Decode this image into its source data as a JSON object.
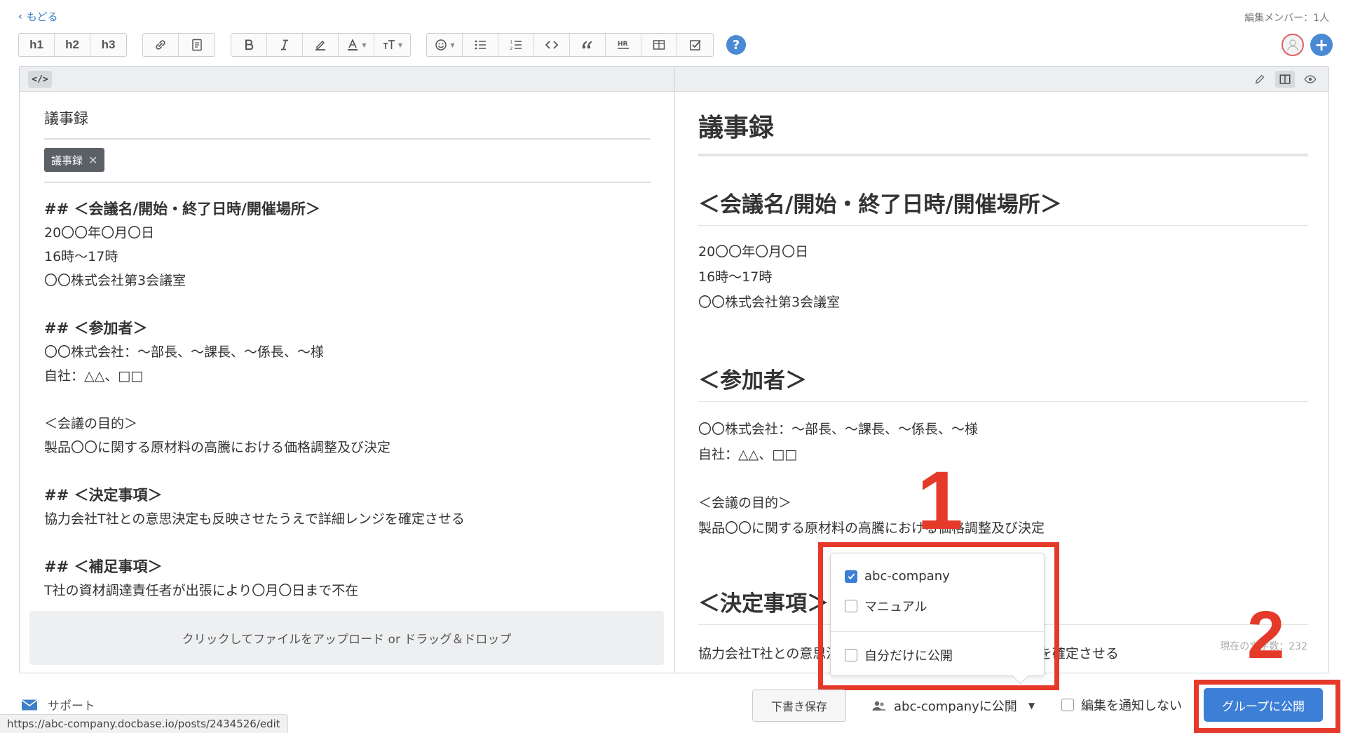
{
  "nav": {
    "back_label": "もどる",
    "editors_label": "編集メンバー：1人"
  },
  "toolbar": {
    "headings": [
      "h1",
      "h2",
      "h3"
    ],
    "help_label": "?"
  },
  "editor": {
    "title": "議事録",
    "tag": "議事録",
    "lines": [
      {
        "text": "## ＜会議名/開始・終了日時/開催場所＞",
        "heading": true
      },
      {
        "text": "20〇〇年〇月〇日",
        "heading": false
      },
      {
        "text": "16時〜17時",
        "heading": false
      },
      {
        "text": "〇〇株式会社第3会議室",
        "heading": false
      },
      {
        "text": "",
        "heading": false
      },
      {
        "text": "## ＜参加者＞",
        "heading": true
      },
      {
        "text": "〇〇株式会社：〜部長、〜課長、〜係長、〜様",
        "heading": false
      },
      {
        "text": "自社：△△、□□",
        "heading": false
      },
      {
        "text": "",
        "heading": false
      },
      {
        "text": "＜会議の目的＞",
        "heading": false
      },
      {
        "text": "製品〇〇に関する原材料の高騰における価格調整及び決定",
        "heading": false
      },
      {
        "text": "",
        "heading": false
      },
      {
        "text": "## ＜決定事項＞",
        "heading": true
      },
      {
        "text": "協力会社T社との意思決定も反映させたうえで詳細レンジを確定させる",
        "heading": false
      },
      {
        "text": "",
        "heading": false
      },
      {
        "text": "## ＜補足事項＞",
        "heading": true
      },
      {
        "text": "T社の資材調達責任者が出張により〇月〇日まで不在",
        "heading": false
      }
    ],
    "upload_label": "クリックしてファイルをアップロード or ドラッグ＆ドロップ"
  },
  "preview": {
    "title": "議事録",
    "h2_meeting": "＜会議名/開始・終了日時/開催場所＞",
    "meeting_date": "20〇〇年〇月〇日",
    "meeting_time": "16時〜17時",
    "meeting_place": "〇〇株式会社第3会議室",
    "h2_participants": "＜参加者＞",
    "participants_client": "〇〇株式会社：〜部長、〜課長、〜係長、〜様",
    "participants_self": "自社：△△、□□",
    "purpose_heading": "＜会議の目的＞",
    "purpose_text": "製品〇〇に関する原材料の高騰における価格調整及び決定",
    "h2_decisions": "＜決定事項＞",
    "decisions_text": "協力会社T社との意思決定も反映させたうえで詳細レンジを確定させる",
    "char_count": "現在の文字数：232"
  },
  "publish_popover": {
    "options": [
      {
        "label": "abc-company",
        "checked": true
      },
      {
        "label": "マニュアル",
        "checked": false
      }
    ],
    "private_label": "自分だけに公開",
    "private_checked": false
  },
  "annotations": {
    "step1": "1",
    "step2": "2",
    "color": "#e5392a"
  },
  "footer": {
    "support_label": "サポート",
    "status_url": "https://abc-company.docbase.io/posts/2434526/edit",
    "draft_label": "下書き保存",
    "scope_label": "abc-companyに公開",
    "notify_label": "編集を通知しない",
    "publish_label": "グループに公開"
  },
  "colors": {
    "accent": "#3d7fd6",
    "link": "#3d7fc7",
    "tag_bg": "#5b6066"
  }
}
